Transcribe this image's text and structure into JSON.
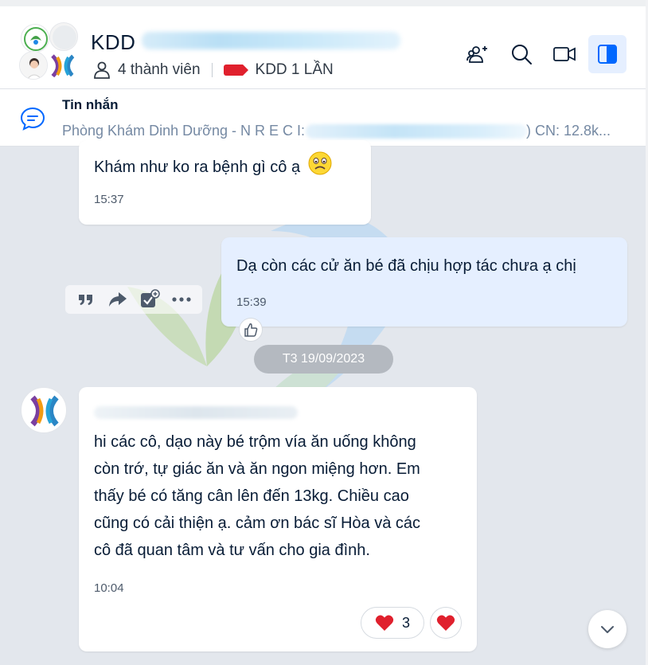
{
  "header": {
    "group_name": "KDD",
    "member_count": "4 thành viên",
    "label_tag": "KDD 1 LẦN",
    "label_color": "#e0202d"
  },
  "icons": {
    "add_member": "add-user-icon",
    "search": "search-icon",
    "video_call": "video-camera-icon",
    "panel_toggle": "sidebar-panel-icon"
  },
  "pinned": {
    "title": "Tin nhắn",
    "text_start": "Phòng Khám Dinh Dưỡng - N R E C I:",
    "text_end": ")  CN: 12.8k..."
  },
  "messages": [
    {
      "side": "incoming",
      "text": "Khám như ko ra bệnh gì cô ạ",
      "emoji": "🙁",
      "time": "15:37"
    },
    {
      "side": "outgoing",
      "text": "Dạ còn các cử ăn bé đã chịu hợp tác chưa ạ chị",
      "time": "15:39"
    },
    {
      "side": "incoming",
      "text_lines": [
        "hi các cô, dạo này bé trộm vía ăn uống không",
        "còn trớ, tự giác ăn và ăn ngon miệng hơn. Em",
        "thấy bé có tăng cân lên đến 13kg. Chiều cao",
        "cũng có cải thiện ạ. cảm ơn bác sĩ Hòa và các",
        "cô đã quan tâm và tư vấn cho gia đình."
      ],
      "time": "10:04",
      "reaction_count": "3"
    }
  ],
  "date_separator": "T3 19/09/2023",
  "colors": {
    "accent": "#0068ff",
    "outgoing_bubble": "#e5efff",
    "heart": "#e0202d"
  }
}
